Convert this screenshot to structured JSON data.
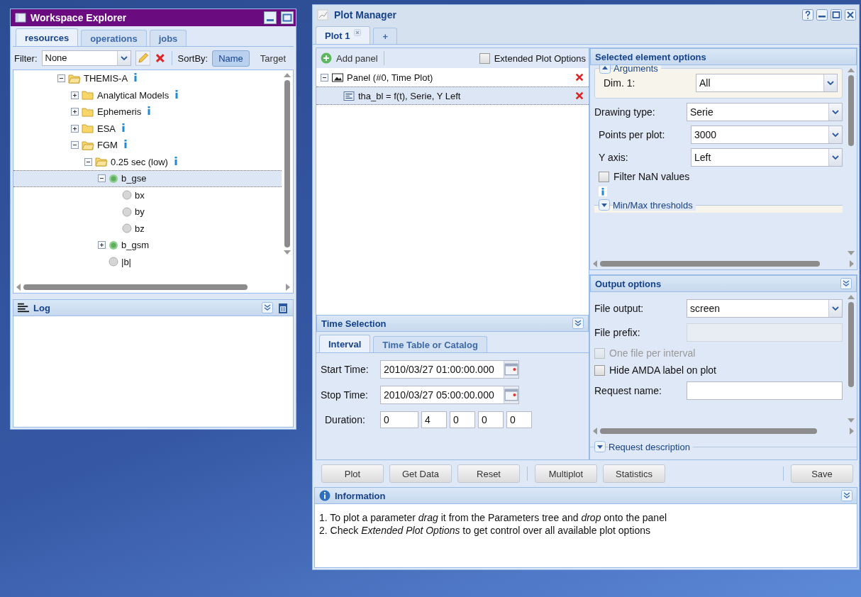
{
  "explorer": {
    "title": "Workspace Explorer",
    "tabs": [
      {
        "label": "resources",
        "selected": true
      },
      {
        "label": "operations",
        "selected": false
      },
      {
        "label": "jobs",
        "selected": false
      }
    ],
    "filter": {
      "label": "Filter:",
      "value": "None"
    },
    "sort": {
      "label": "SortBy:",
      "options": [
        {
          "label": "Name",
          "selected": true
        },
        {
          "label": "Target",
          "selected": false
        }
      ]
    },
    "tree": [
      {
        "label": "THEMIS-A",
        "kind": "folder",
        "expanded": true,
        "info": true,
        "selected": false,
        "children": [
          {
            "label": "Analytical Models",
            "kind": "folder",
            "expanded": false,
            "info": true,
            "selected": false
          },
          {
            "label": "Ephemeris",
            "kind": "folder",
            "expanded": false,
            "info": true,
            "selected": false
          },
          {
            "label": "ESA",
            "kind": "folder",
            "expanded": false,
            "info": true,
            "selected": false
          },
          {
            "label": "FGM",
            "kind": "folder",
            "expanded": true,
            "info": true,
            "selected": false,
            "children": [
              {
                "label": "0.25 sec (low)",
                "kind": "folder",
                "expanded": true,
                "info": true,
                "selected": false,
                "children": [
                  {
                    "label": "b_gse",
                    "kind": "parameter",
                    "expanded": true,
                    "info": false,
                    "selected": true,
                    "children": [
                      {
                        "label": "bx",
                        "kind": "component",
                        "info": false,
                        "selected": false
                      },
                      {
                        "label": "by",
                        "kind": "component",
                        "info": false,
                        "selected": false
                      },
                      {
                        "label": "bz",
                        "kind": "component",
                        "info": false,
                        "selected": false
                      }
                    ]
                  },
                  {
                    "label": "b_gsm",
                    "kind": "parameter",
                    "expanded": false,
                    "info": false,
                    "selected": false
                  },
                  {
                    "label": "|b|",
                    "kind": "component",
                    "info": false,
                    "selected": false
                  }
                ]
              }
            ]
          }
        ]
      }
    ]
  },
  "log": {
    "title": "Log"
  },
  "plot_manager": {
    "title": "Plot Manager",
    "tabs": [
      {
        "label": "Plot 1",
        "selected": true,
        "closable": true
      },
      {
        "label": "+",
        "selected": false,
        "closable": false
      }
    ],
    "add_panel": "Add panel",
    "extended_options": {
      "label": "Extended Plot Options",
      "checked": false
    },
    "panel_tree": [
      {
        "label": "Panel (#0, Time Plot)",
        "kind": "panel",
        "expanded": true,
        "selected": false,
        "children": [
          {
            "label": "tha_bl = f(t), Serie, Y Left",
            "kind": "parameter",
            "selected": true
          }
        ]
      }
    ],
    "time_selection": {
      "title": "Time Selection",
      "tabs": [
        {
          "label": "Interval",
          "selected": true
        },
        {
          "label": "Time Table or Catalog",
          "selected": false
        }
      ],
      "start": {
        "label": "Start Time:",
        "value": "2010/03/27 01:00:00.000"
      },
      "stop": {
        "label": "Stop Time:",
        "value": "2010/03/27 05:00:00.000"
      },
      "duration": {
        "label": "Duration:",
        "values": [
          "0",
          "4",
          "0",
          "0",
          "0"
        ]
      }
    },
    "selected_options": {
      "title": "Selected element options",
      "arguments": {
        "legend": "Arguments",
        "expanded": true,
        "fields": [
          {
            "label": "Dim. 1:",
            "value": "All"
          }
        ]
      },
      "fields": [
        {
          "kind": "combo",
          "label": "Drawing type:",
          "value": "Serie"
        },
        {
          "kind": "combo",
          "label": "Points per plot:",
          "value": "3000"
        },
        {
          "kind": "combo",
          "label": "Y axis:",
          "value": "Left"
        },
        {
          "kind": "checkbox",
          "label": "Filter NaN values",
          "checked": false,
          "disabled": false
        },
        {
          "kind": "info"
        },
        {
          "kind": "fieldset",
          "legend": "Min/Max thresholds",
          "expanded": false
        }
      ]
    },
    "output_options": {
      "title": "Output options",
      "fields": [
        {
          "kind": "combo",
          "label": "File output:",
          "value": "screen"
        },
        {
          "kind": "text",
          "label": "File prefix:",
          "disabled": true
        },
        {
          "kind": "checkbox",
          "label": "One file per interval",
          "checked": false,
          "disabled": true
        },
        {
          "kind": "checkbox",
          "label": "Hide AMDA label on plot",
          "checked": false,
          "disabled": false
        },
        {
          "kind": "text",
          "label": "Request name:",
          "disabled": false
        }
      ],
      "description": {
        "legend": "Request description",
        "expanded": false
      }
    },
    "button_groups": [
      [
        "Plot",
        "Get Data",
        "Reset"
      ],
      [
        "Multiplot",
        "Statistics"
      ],
      [
        "Save"
      ]
    ],
    "information": {
      "title": "Information",
      "lines": [
        "1. To plot a parameter *drag* it from the Parameters tree and *drop* onto the panel",
        "2. Check *Extended Plot Options* to get control over all available plot options"
      ]
    }
  }
}
